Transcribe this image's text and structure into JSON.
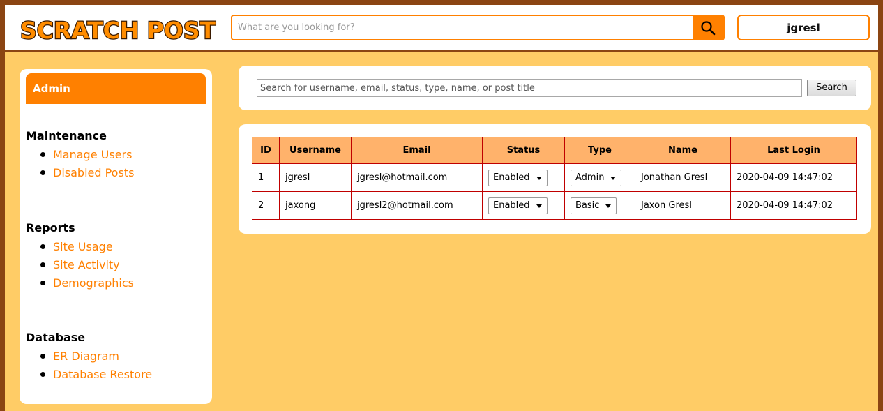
{
  "header": {
    "logo_text": "SCRATCH POST",
    "search_placeholder": "What are you looking for?",
    "search_icon": "magnifier-icon",
    "username": "jgresl"
  },
  "sidebar": {
    "title": "Admin",
    "sections": [
      {
        "title": "Maintenance",
        "items": [
          "Manage Users",
          "Disabled Posts"
        ]
      },
      {
        "title": "Reports",
        "items": [
          "Site Usage",
          "Site Activity",
          "Demographics"
        ]
      },
      {
        "title": "Database",
        "items": [
          "ER Diagram",
          "Database Restore"
        ]
      }
    ]
  },
  "user_search": {
    "placeholder": "Search for username, email, status, type, name, or post title",
    "button_label": "Search"
  },
  "users_table": {
    "headers": [
      "ID",
      "Username",
      "Email",
      "Status",
      "Type",
      "Name",
      "Last Login"
    ],
    "rows": [
      {
        "id": "1",
        "username": "jgresl",
        "email": "jgresl@hotmail.com",
        "status": "Enabled",
        "type": "Admin",
        "name": "Jonathan Gresl",
        "last_login": "2020-04-09 14:47:02"
      },
      {
        "id": "2",
        "username": "jaxong",
        "email": "jgresl2@hotmail.com",
        "status": "Enabled",
        "type": "Basic",
        "name": "Jaxon Gresl",
        "last_login": "2020-04-09 14:47:02"
      }
    ]
  },
  "colors": {
    "accent": "#ff8000",
    "background": "#ffcc66",
    "frame_border": "#8b4513",
    "table_header": "#ffb26b",
    "table_border": "#c00000"
  }
}
